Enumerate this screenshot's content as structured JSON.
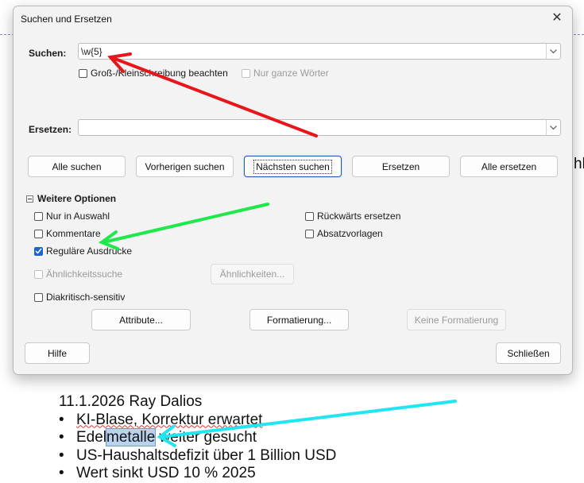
{
  "dialog": {
    "title": "Suchen und Ersetzen",
    "close_glyph": "✕",
    "search": {
      "label": "Suchen:",
      "value": "\\w{5}"
    },
    "options_top": [
      {
        "label": "Groß-/Kleinschreibung beachten",
        "checked": false,
        "disabled": false
      },
      {
        "label": "Nur ganze Wörter",
        "checked": false,
        "disabled": true
      }
    ],
    "replace": {
      "label": "Ersetzen:",
      "value": ""
    },
    "buttons": {
      "find_all": "Alle suchen",
      "find_prev": "Vorherigen suchen",
      "find_next": "Nächsten suchen",
      "replace": "Ersetzen",
      "replace_all": "Alle ersetzen"
    },
    "more_options_label": "Weitere Optionen",
    "options_left": [
      {
        "label": "Nur in Auswahl",
        "checked": false
      },
      {
        "label": "Kommentare",
        "checked": false
      },
      {
        "label": "Reguläre Ausdrücke",
        "checked": true
      }
    ],
    "options_right": [
      {
        "label": "Rückwärts ersetzen",
        "checked": false
      },
      {
        "label": "Absatzvorlagen",
        "checked": false
      }
    ],
    "similarity": {
      "label": "Ähnlichkeitssuche",
      "checked": false,
      "disabled": true,
      "button": "Ähnlichkeiten..."
    },
    "diacritic": {
      "label": "Diakritisch-sensitiv",
      "checked": false
    },
    "format_buttons": {
      "attributes": "Attribute...",
      "format": "Formatierung...",
      "no_format": "Keine Formatierung"
    },
    "help": "Hilfe",
    "close": "Schließen"
  },
  "document": {
    "right_fragment": "hl",
    "heading": "11.1.2026 Ray Dalios",
    "bullets": [
      {
        "parts": [
          "KI-Blase, Korrektur erwartet"
        ]
      },
      {
        "pre": "Edel",
        "highlight": "metalle",
        "post": " weiter gesucht"
      },
      {
        "parts": [
          "US-Haushaltsdefizit über 1 Billion USD"
        ]
      },
      {
        "parts": [
          "Wert sinkt USD 10 % 2025"
        ]
      }
    ]
  },
  "colors": {
    "accent": "#1f64c8",
    "arrow_red": "#e8151b",
    "arrow_green": "#1ee84a",
    "arrow_cyan": "#1fe6f0"
  }
}
